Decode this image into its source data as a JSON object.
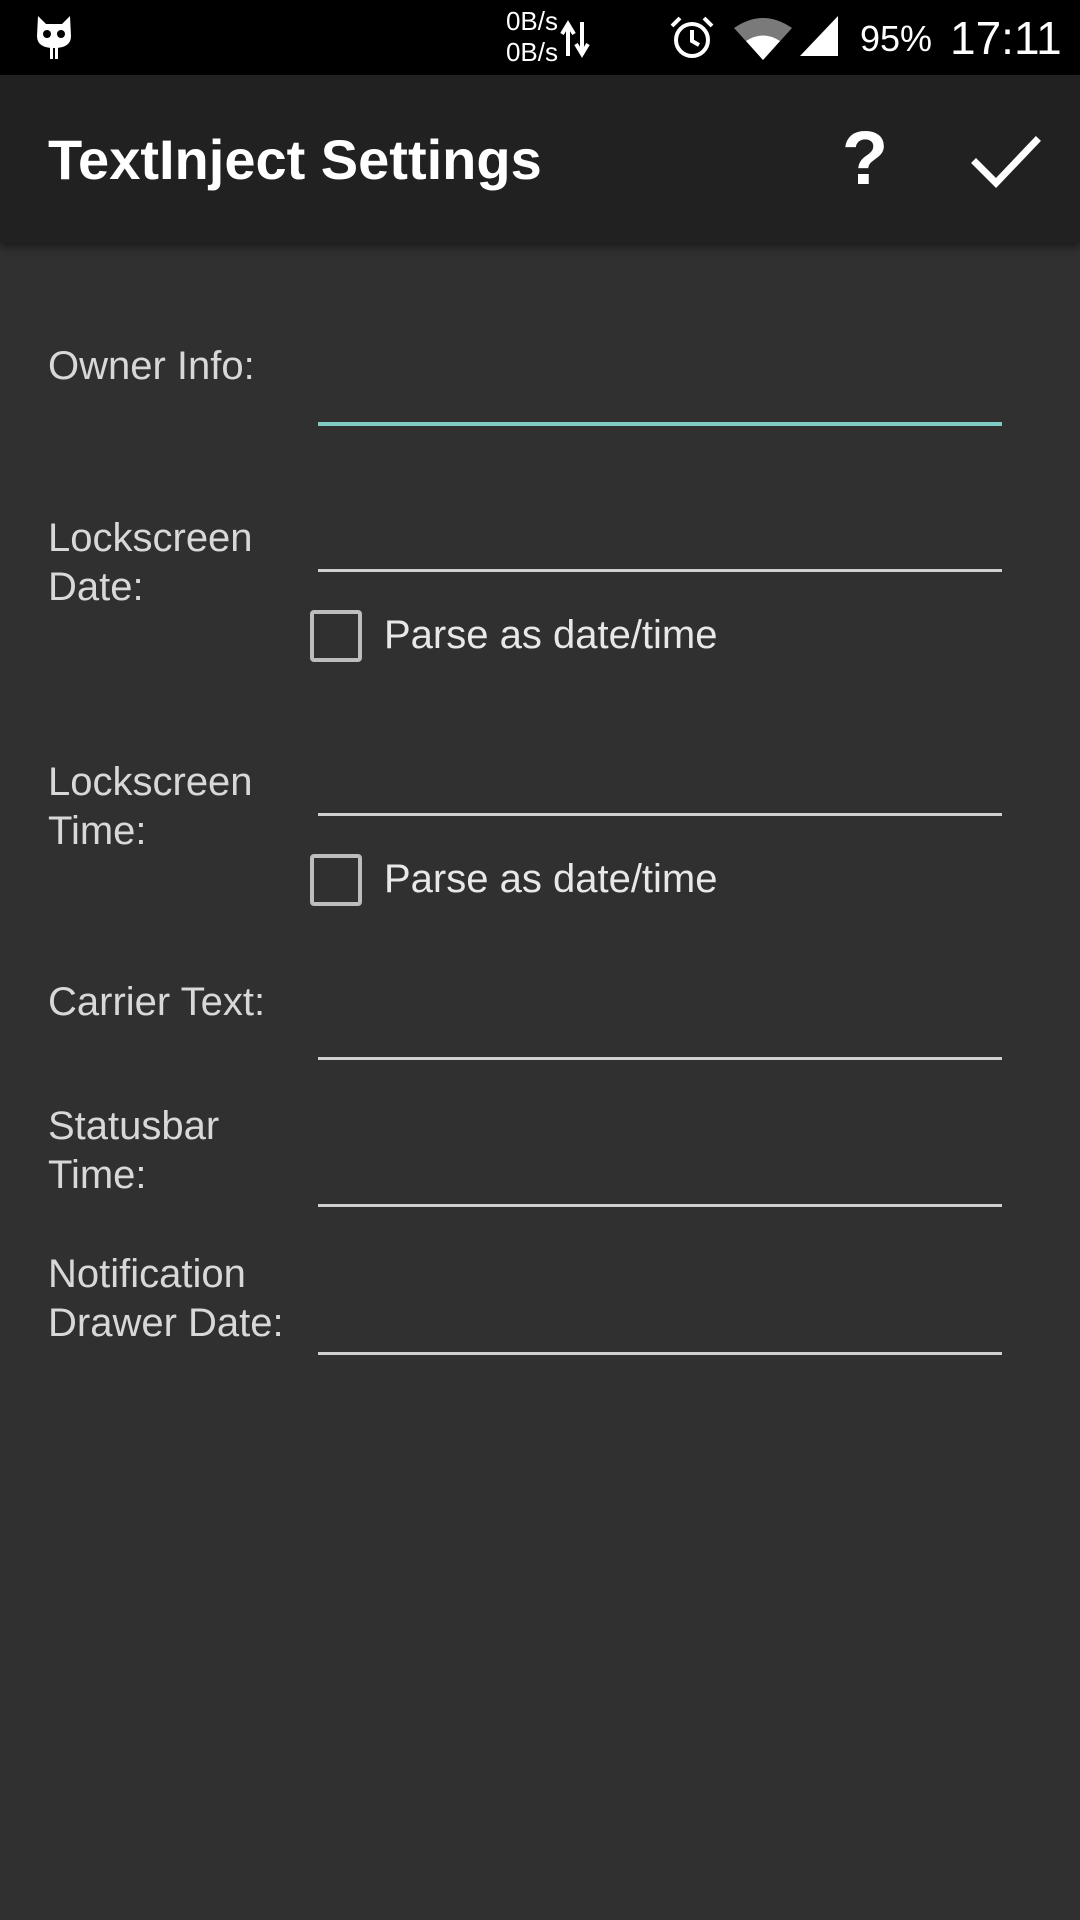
{
  "status_bar": {
    "net_up": "0B/s",
    "net_down": "0B/s",
    "battery": "95%",
    "clock": "17:11",
    "icons": [
      "cyanogen-cat-icon",
      "data-arrows-icon",
      "alarm-icon",
      "wifi-icon",
      "signal-icon"
    ]
  },
  "app_bar": {
    "title": "TextInject Settings",
    "help_label": "?",
    "icons": [
      "help-icon",
      "checkmark-icon"
    ]
  },
  "form": {
    "owner_info": {
      "label": "Owner Info:",
      "value": "",
      "focused": true
    },
    "lockscreen_date": {
      "label_line1": "Lockscreen",
      "label_line2": "Date:",
      "value": "",
      "parse_label": "Parse as date/time",
      "parse_checked": false
    },
    "lockscreen_time": {
      "label_line1": "Lockscreen",
      "label_line2": "Time:",
      "value": "",
      "parse_label": "Parse as date/time",
      "parse_checked": false
    },
    "carrier_text": {
      "label": "Carrier Text:",
      "value": ""
    },
    "statusbar_time": {
      "label_line1": "Statusbar",
      "label_line2": "Time:",
      "value": ""
    },
    "notification_drawer_date": {
      "label_line1": "Notification",
      "label_line2": "Drawer Date:",
      "value": ""
    }
  },
  "colors": {
    "background": "#303030",
    "app_bar": "#212121",
    "status_bar": "#000000",
    "accent_underline": "#80cbc4",
    "underline": "#cfcfcf"
  }
}
